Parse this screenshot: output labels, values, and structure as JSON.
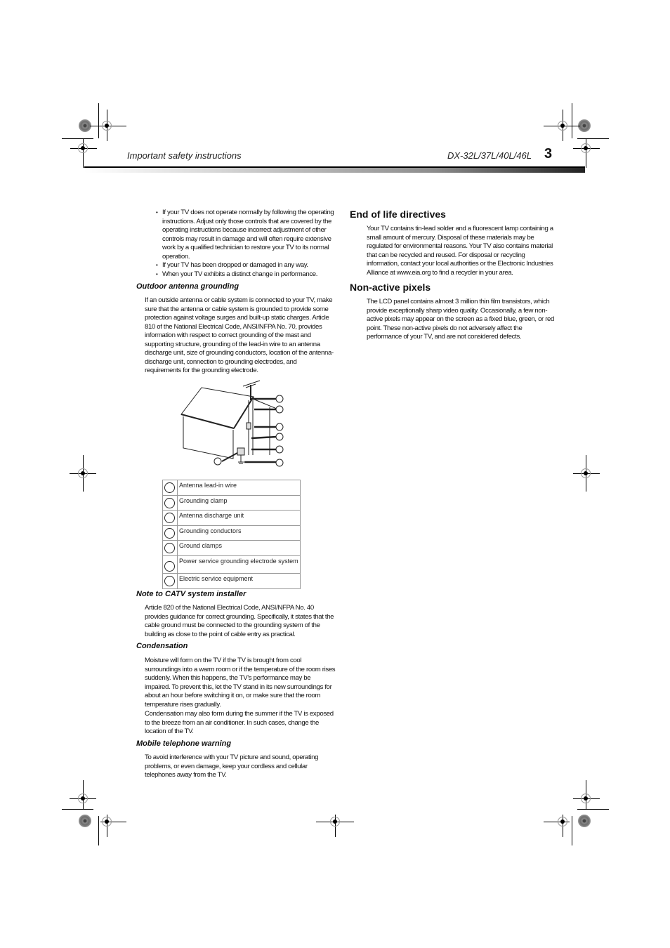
{
  "header": {
    "section_title": "Important safety instructions",
    "model": "DX-32L/37L/40L/46L",
    "page_number": "3"
  },
  "left_column": {
    "bullets": [
      "If your TV does not operate normally by following the operating instructions. Adjust only those controls that are covered by the operating instructions because incorrect adjustment of other controls may result in damage and will often require extensive work by a qualified technician to restore your TV to its normal operation.",
      "If your TV has been dropped or damaged in any way.",
      "When your TV exhibits a distinct change in performance."
    ],
    "outdoor_antenna": {
      "heading": "Outdoor antenna grounding",
      "text": "If an outside antenna or cable system is connected to your TV, make sure that the antenna or cable system is grounded to provide some protection against voltage surges and built-up static charges. Article 810 of the National Electrical Code, ANSI/NFPA No. 70, provides information with respect to correct grounding of the mast and supporting structure, grounding of the lead-in wire to an antenna discharge unit, size of grounding conductors, location of the antenna-discharge unit, connection to grounding electrodes, and requirements for the grounding electrode."
    },
    "legend": [
      "Antenna lead-in wire",
      "Grounding clamp",
      "Antenna discharge unit",
      "Grounding conductors",
      "Ground clamps",
      "Power service grounding electrode system",
      "Electric service equipment"
    ],
    "catv": {
      "heading": "Note to CATV system installer",
      "text": "Article 820 of the National Electrical Code, ANSI/NFPA No. 40 provides guidance for correct grounding. Specifically, it states that the cable ground must be connected to the grounding system of the building as close to the point of cable entry as practical."
    },
    "condensation": {
      "heading": "Condensation",
      "text1": "Moisture will form on the TV if the TV is brought from cool surroundings into a warm room or if the temperature of the room rises suddenly. When this happens, the TV's performance may be impaired. To prevent this, let the TV stand in its new surroundings for about an hour before switching it on, or make sure that the room temperature rises gradually.",
      "text2": "Condensation may also form during the summer if the TV is exposed to the breeze from an air conditioner. In such cases, change the location of the TV."
    },
    "mobile": {
      "heading": "Mobile telephone warning",
      "text": "To avoid interference with your TV picture and sound, operating problems, or even damage, keep your cordless and cellular telephones away from the TV."
    }
  },
  "right_column": {
    "end_of_life": {
      "heading": "End of life directives",
      "text": "Your TV contains tin-lead solder and a fluorescent lamp containing a small amount of mercury. Disposal of these materials may be regulated for environmental reasons. Your TV also contains material that can be recycled and reused. For disposal or recycling information, contact your local authorities or the Electronic Industries Alliance at www.eia.org to find a recycler in your area."
    },
    "non_active_pixels": {
      "heading": "Non-active pixels",
      "text": "The LCD panel contains almost 3 million thin film transistors, which provide exceptionally sharp video quality. Occasionally, a few non-active pixels may appear on the screen as a fixed blue, green, or red point. These non-active pixels do not adversely affect the performance of your TV, and are not considered defects."
    }
  }
}
